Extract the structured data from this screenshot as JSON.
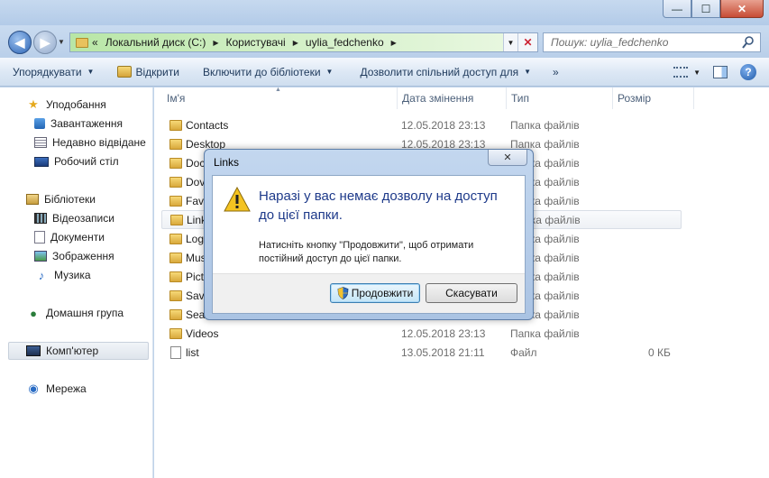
{
  "window": {
    "min_glyph": "—",
    "max_glyph": "☐",
    "close_glyph": "✕"
  },
  "address": {
    "prefix": "«",
    "crumbs": [
      "Локальний диск (C:)",
      "Користувачі",
      "uylia_fedchenko"
    ],
    "search_placeholder": "Пошук: uylia_fedchenko"
  },
  "toolbar": {
    "organize": "Упорядкувати",
    "open": "Відкрити",
    "include_library": "Включити до бібліотеки",
    "share": "Дозволити спільний доступ для",
    "more": "»"
  },
  "nav": {
    "favorites": "Уподобання",
    "downloads": "Завантаження",
    "recent": "Недавно відвідане",
    "desktop": "Робочий стіл",
    "libraries": "Бібліотеки",
    "videos": "Відеозаписи",
    "documents": "Документи",
    "pictures": "Зображення",
    "music": "Музика",
    "homegroup": "Домашня група",
    "computer": "Комп'ютер",
    "network": "Мережа"
  },
  "columns": {
    "name": "Ім'я",
    "date": "Дата змінення",
    "type": "Тип",
    "size": "Розмір"
  },
  "files": [
    {
      "name": "Contacts",
      "date": "12.05.2018 23:13",
      "type": "Папка файлів",
      "size": ""
    },
    {
      "name": "Desktop",
      "date": "12.05.2018 23:13",
      "type": "Папка файлів",
      "size": ""
    },
    {
      "name": "Doc",
      "date": "",
      "type": "Папка файлів",
      "size": ""
    },
    {
      "name": "Dov",
      "date": "",
      "type": "Папка файлів",
      "size": ""
    },
    {
      "name": "Fav",
      "date": "",
      "type": "Папка файлів",
      "size": ""
    },
    {
      "name": "Link",
      "date": "",
      "type": "Папка файлів",
      "size": ""
    },
    {
      "name": "Log",
      "date": "",
      "type": "Папка файлів",
      "size": ""
    },
    {
      "name": "Mus",
      "date": "",
      "type": "Папка файлів",
      "size": ""
    },
    {
      "name": "Pict",
      "date": "",
      "type": "Папка файлів",
      "size": ""
    },
    {
      "name": "Save",
      "date": "",
      "type": "Папка файлів",
      "size": ""
    },
    {
      "name": "Sea",
      "date": "",
      "type": "Папка файлів",
      "size": ""
    },
    {
      "name": "Videos",
      "date": "12.05.2018 23:13",
      "type": "Папка файлів",
      "size": ""
    },
    {
      "name": "list",
      "date": "13.05.2018 21:11",
      "type": "Файл",
      "size": "0 КБ"
    }
  ],
  "dialog": {
    "title": "Links",
    "close_glyph": "✕",
    "heading": "Наразі у вас немає дозволу на доступ до цієї папки.",
    "message": "Натисніть кнопку \"Продовжити\", щоб отримати постійний доступ до цієї папки.",
    "continue": "Продовжити",
    "cancel": "Скасувати"
  }
}
